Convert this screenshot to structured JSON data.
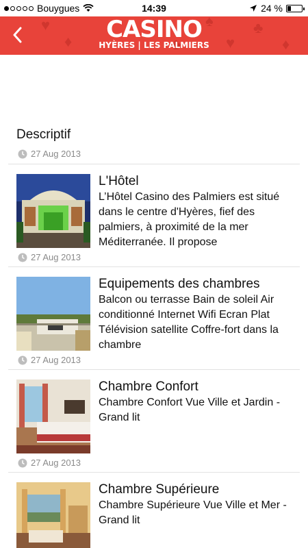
{
  "status_bar": {
    "carrier": "Bouygues",
    "time": "14:39",
    "battery": "24 %",
    "battery_level": 0.24,
    "signal_bars_filled": 1,
    "signal_bars_total": 5
  },
  "header": {
    "logo_main": "CASINO",
    "logo_sub": "HYÈRES | LES PALMIERS",
    "back_icon": "chevron-left-icon",
    "accent_color": "#e8433a"
  },
  "section": {
    "title": "Descriptif",
    "date": "27 Aug 2013"
  },
  "items": [
    {
      "title": "L'Hôtel",
      "description": "L’Hôtel Casino des Palmiers est situé dans le centre d'Hyères, fief des palmiers, à proximité de la mer Méditerranée. Il propose",
      "date": "27 Aug 2013",
      "image": "hotel-facade-night"
    },
    {
      "title": "Equipements des chambres",
      "description": "Balcon ou terrasse  Bain de soleil  Air conditionné Internet  Wifi  Ecran Plat  Télévision satellite  Coffre-fort dans la chambre",
      "date": "27 Aug 2013",
      "image": "rooftop-view"
    },
    {
      "title": "Chambre Confort",
      "description": "Chambre Confort Vue Ville et Jardin - Grand lit",
      "date": "27 Aug 2013",
      "image": "comfort-room"
    },
    {
      "title": "Chambre Supérieure",
      "description": "Chambre Supérieure Vue Ville et Mer - Grand lit",
      "date": "",
      "image": "superior-room"
    }
  ]
}
